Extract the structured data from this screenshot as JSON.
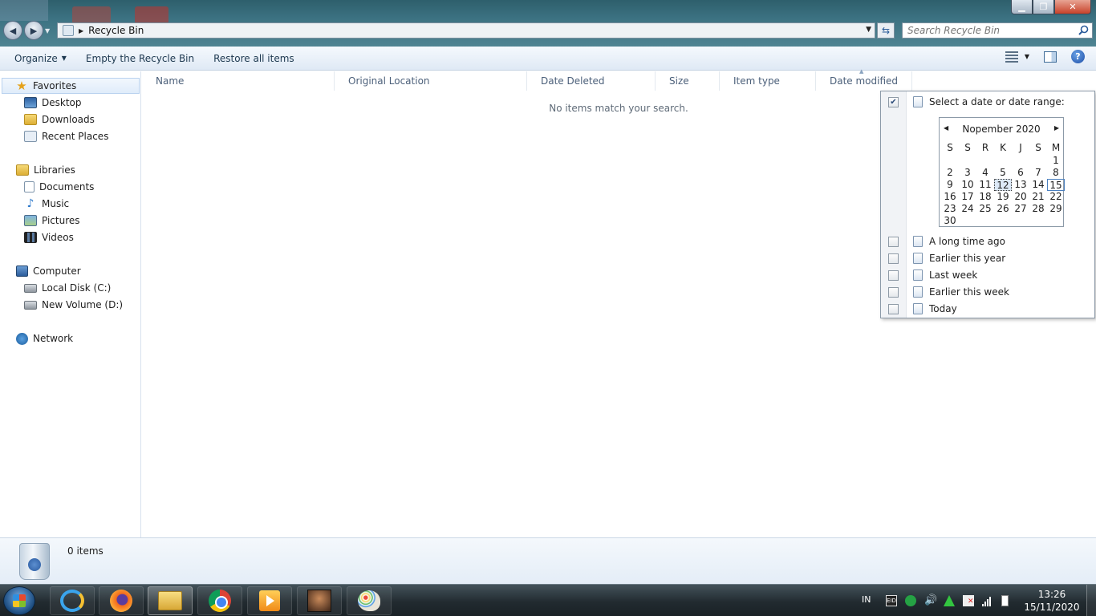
{
  "window": {
    "address": "Recycle Bin",
    "search_placeholder": "Search Recycle Bin",
    "minimize": "▁",
    "maximize": "❐",
    "close": "✕"
  },
  "toolbar": {
    "organize": "Organize",
    "empty": "Empty the Recycle Bin",
    "restore": "Restore all items"
  },
  "sidebar": {
    "favorites": "Favorites",
    "desktop": "Desktop",
    "downloads": "Downloads",
    "recent": "Recent Places",
    "libraries": "Libraries",
    "documents": "Documents",
    "music": "Music",
    "pictures": "Pictures",
    "videos": "Videos",
    "computer": "Computer",
    "local_disk": "Local Disk (C:)",
    "new_volume": "New Volume (D:)",
    "network": "Network"
  },
  "columns": [
    "Name",
    "Original Location",
    "Date Deleted",
    "Size",
    "Item type",
    "Date modified"
  ],
  "empty_message": "No items match your search.",
  "date_filter": {
    "select_label": "Select a date or date range:",
    "select_checked": true,
    "month_title": "Nopember 2020",
    "dow": [
      "S",
      "S",
      "R",
      "K",
      "J",
      "S",
      "M"
    ],
    "weeks": [
      [
        "",
        "",
        "",
        "",
        "",
        "",
        "1"
      ],
      [
        "2",
        "3",
        "4",
        "5",
        "6",
        "7",
        "8"
      ],
      [
        "9",
        "10",
        "11",
        "12",
        "13",
        "14",
        "15"
      ],
      [
        "16",
        "17",
        "18",
        "19",
        "20",
        "21",
        "22"
      ],
      [
        "23",
        "24",
        "25",
        "26",
        "27",
        "28",
        "29"
      ],
      [
        "30",
        "",
        "",
        "",
        "",
        "",
        ""
      ]
    ],
    "focused_day": "12",
    "today_day": "15",
    "options": [
      "A long time ago",
      "Earlier this year",
      "Last week",
      "Earlier this week",
      "Today"
    ]
  },
  "details": {
    "count": "0 items"
  },
  "taskbar": {
    "language": "IN",
    "time": "13:26",
    "date": "15/11/2020",
    "eid_label": "EID"
  }
}
